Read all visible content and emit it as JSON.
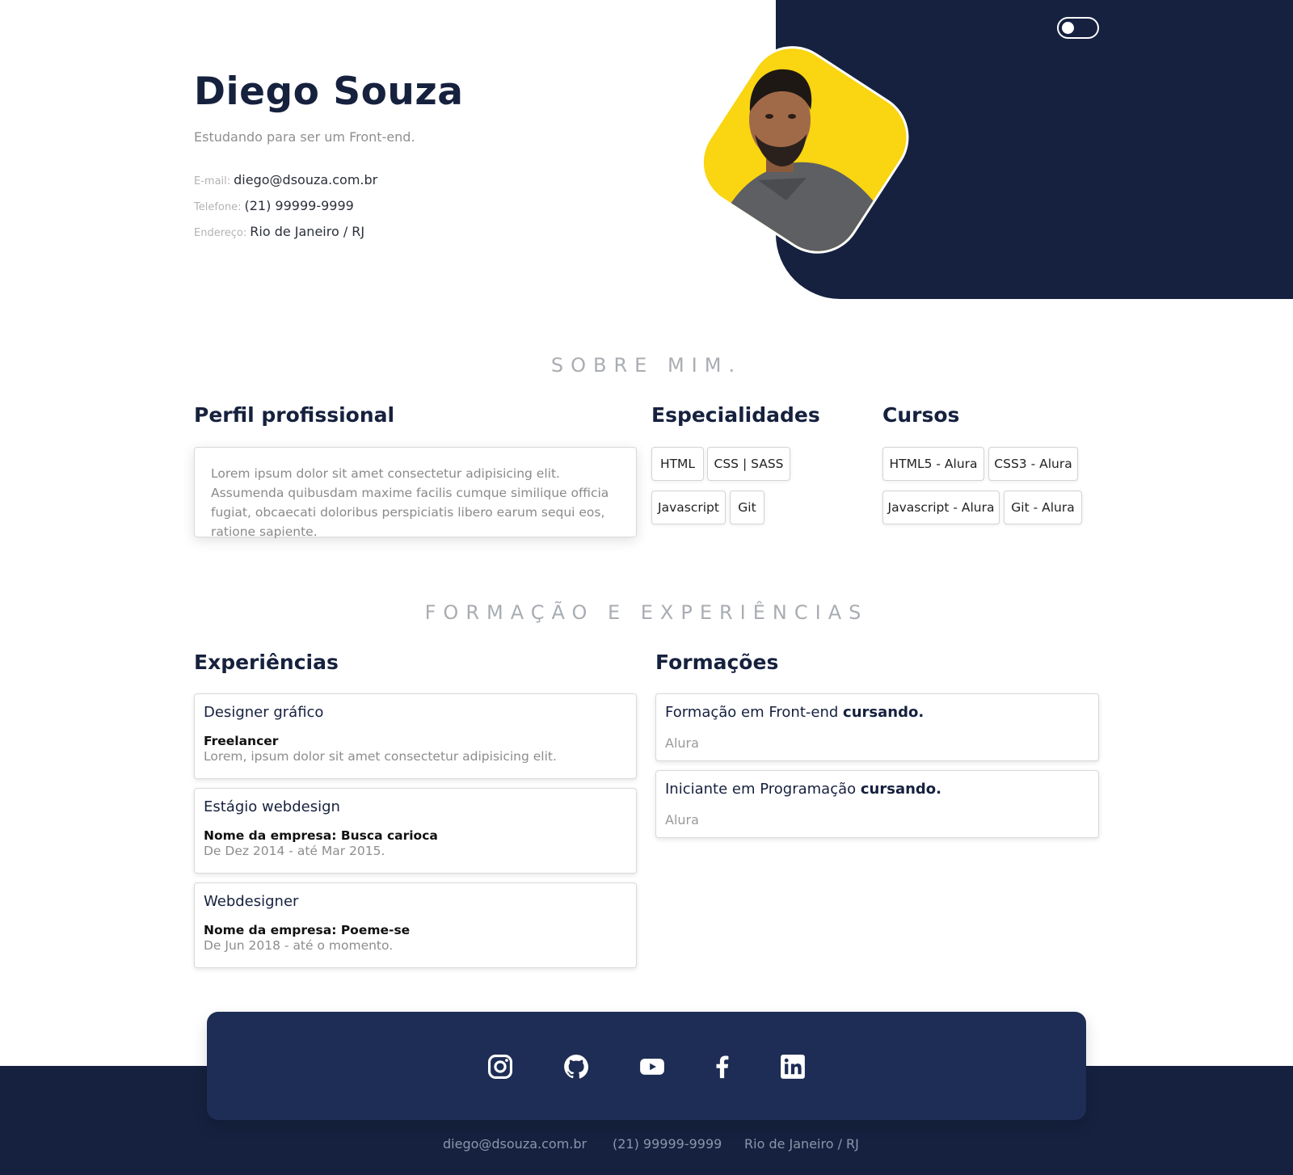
{
  "header": {
    "name": "Diego Souza",
    "subtitle": "Estudando para ser um Front-end.",
    "contacts": [
      {
        "label": "E-mail:",
        "value": "diego@dsouza.com.br"
      },
      {
        "label": "Telefone:",
        "value": "(21) 99999-9999"
      },
      {
        "label": "Endereço:",
        "value": "Rio de Janeiro / RJ"
      }
    ]
  },
  "sections": {
    "about_title": "SOBRE MIM.",
    "experience_title": "FORMAÇÃO E EXPERIÊNCIAS"
  },
  "profile": {
    "heading": "Perfil profissional",
    "text": "Lorem ipsum dolor sit amet consectetur adipisicing elit. Assumenda quibusdam maxime facilis cumque similique officia fugiat, obcaecati doloribus perspiciatis libero earum sequi eos, ratione sapiente."
  },
  "specialties": {
    "heading": "Especialidades",
    "items": [
      "HTML",
      "CSS | SASS",
      "Javascript",
      "Git"
    ]
  },
  "courses": {
    "heading": "Cursos",
    "items": [
      "HTML5 - Alura",
      "CSS3 - Alura",
      "Javascript - Alura",
      "Git - Alura"
    ]
  },
  "experiences": {
    "heading": "Experiências",
    "items": [
      {
        "title": "Designer gráfico",
        "company": "Freelancer",
        "detail": "Lorem, ipsum dolor sit amet consectetur adipisicing elit."
      },
      {
        "title": "Estágio webdesign",
        "company": "Nome da empresa: Busca carioca",
        "detail": "De Dez 2014 - até Mar 2015."
      },
      {
        "title": "Webdesigner",
        "company": "Nome da empresa: Poeme-se",
        "detail": "De Jun 2018 - até o momento."
      }
    ]
  },
  "formations": {
    "heading": "Formações",
    "items": [
      {
        "title": "Formação em Front-end",
        "status": "cursando.",
        "school": "Alura"
      },
      {
        "title": "Iniciante em Programação",
        "status": "cursando.",
        "school": "Alura"
      }
    ]
  },
  "social": {
    "icons": [
      "instagram-icon",
      "github-icon",
      "youtube-icon",
      "facebook-icon",
      "linkedin-icon"
    ]
  },
  "footer": {
    "email": "diego@dsouza.com.br",
    "phone": "(21) 99999-9999",
    "address": "Rio de Janeiro / RJ"
  },
  "colors": {
    "navy": "#15213f",
    "social_bar": "#1e2d55",
    "accent_yellow": "#f9d512"
  },
  "theme_toggle": {
    "state": "off"
  }
}
